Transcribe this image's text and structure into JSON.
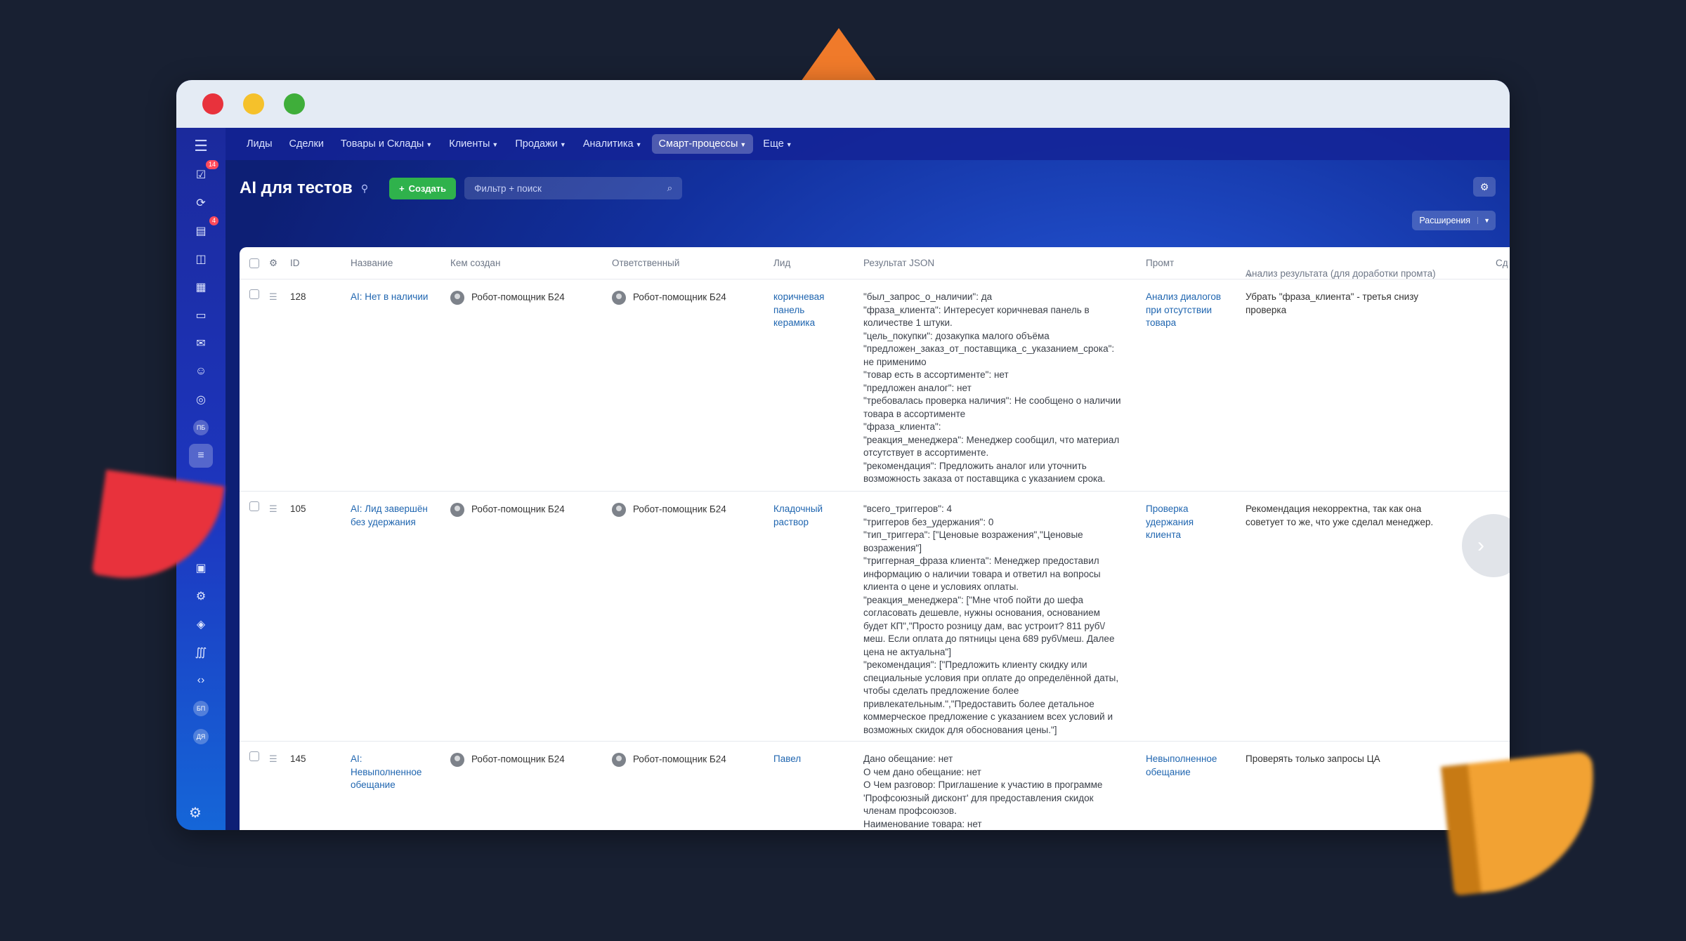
{
  "nav": {
    "items": [
      "Лиды",
      "Сделки",
      "Товары и Склады",
      "Клиенты",
      "Продажи",
      "Аналитика",
      "Смарт-процессы",
      "Еще"
    ],
    "active": "Смарт-процессы"
  },
  "sidebar": {
    "badges": {
      "tasks": "14",
      "feed": "4"
    },
    "labels": {
      "pb": "ПБ",
      "bp": "БП",
      "dr": "ДЯ"
    }
  },
  "page": {
    "title": "AI для тестов",
    "create_label": "Создать",
    "search_placeholder": "Фильтр + поиск",
    "extensions_label": "Расширения"
  },
  "table": {
    "columns": [
      "ID",
      "Название",
      "Кем создан",
      "Ответственный",
      "Лид",
      "Результат JSON",
      "Промт",
      "Анализ результата (для доработки промта)",
      "Сд"
    ],
    "rows": [
      {
        "id": "128",
        "name": "AI: Нет в наличии",
        "created_by": "Робот-помощник Б24",
        "responsible": "Робот-помощник Б24",
        "lead": "коричневая панель керамика",
        "result_json": "\"был_запрос_о_наличии\": да\n\"фраза_клиента\": Интересует коричневая панель в количестве 1 штуки.\n\"цель_покупки\": дозакупка малого объёма\n\"предложен_заказ_от_поставщика_с_указанием_срока\": не применимо\n\"товар есть в ассортименте\": нет\n\"предложен аналог\": нет\n\"требовалась проверка наличия\": Не сообщено о наличии товара в ассортименте\n\"фраза_клиента\":\n\"реакция_менеджера\": Менеджер сообщил, что материал отсутствует в ассортименте.\n\"рекомендация\": Предложить аналог или уточнить возможность заказа от поставщика с указанием срока.",
        "prompt": "Анализ диалогов при отсутствии товара",
        "analysis": "Убрать \"фраза_клиента\" - третья снизу проверка"
      },
      {
        "id": "105",
        "name": "AI: Лид завершён без удержания",
        "created_by": "Робот-помощник Б24",
        "responsible": "Робот-помощник Б24",
        "lead": "Кладочный раствор",
        "result_json": "\"всего_триггеров\": 4\n\"триггеров без_удержания\": 0\n\"тип_триггера\": [\"Ценовые возражения\",\"Ценовые возражения\"]\n\"триггерная_фраза клиента\": Менеджер предоставил информацию о наличии товара и ответил на вопросы клиента о цене и условиях оплаты.\n\"реакция_менеджера\": [\"Мне чтоб пойти до шефа согласовать дешевле, нужны основания, основанием будет КП\",\"Просто розницу дам, вас устроит? 811 руб\\/ меш. Если оплата до пятницы цена 689 руб\\/меш. Далее цена не актуальна\"]\n\"рекомендация\": [\"Предложить клиенту скидку или специальные условия при оплате до определённой даты, чтобы сделать предложение более привлекательным.\",\"Предоставить более детальное коммерческое предложение с указанием всех условий и возможных скидок для обоснования цены.\"]",
        "prompt": "Проверка удержания клиента",
        "analysis": "Рекомендация некорректна, так как она советует то же, что уже сделал менеджер."
      },
      {
        "id": "145",
        "name": "AI: Невыполненное обещание",
        "created_by": "Робот-помощник Б24",
        "responsible": "Робот-помощник Б24",
        "lead": "Павел",
        "result_json": "Дано обещание: нет\nО чем дано обещание: нет\nО Чем разговор: Приглашение к участию в программе 'Профсоюзный дисконт' для предоставления скидок членам профсоюзов.\nНаименование товара: нет",
        "prompt": "Невыполненное обещание",
        "analysis": "Проверять только запросы ЦА"
      }
    ]
  },
  "colors": {
    "accent_green": "#2fb24c",
    "link": "#2066b0",
    "nav_bg": "#1d2bb0"
  }
}
